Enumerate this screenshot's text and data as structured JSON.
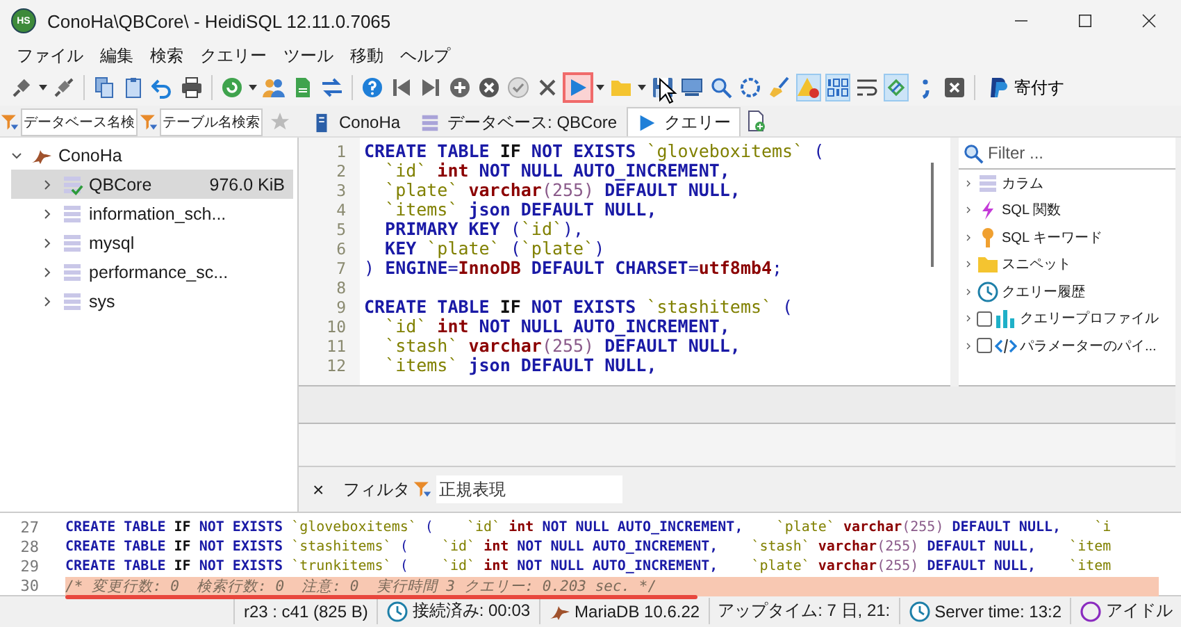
{
  "window": {
    "icon_label": "HS",
    "title": "ConoHa\\QBCore\\ - HeidiSQL 12.11.0.7065"
  },
  "menu": [
    "ファイル",
    "編集",
    "検索",
    "クエリー",
    "ツール",
    "移動",
    "ヘルプ"
  ],
  "toolbar": {
    "run_highlighted": true,
    "toggle_buttons": [
      {
        "pressed": true
      },
      {
        "pressed": true
      },
      {
        "pressed": true
      }
    ],
    "donate_label": "寄付す"
  },
  "search_fields": [
    {
      "placeholder": "データベース名検"
    },
    {
      "placeholder": "テーブル名検索"
    }
  ],
  "tabs": [
    {
      "label": "ConoHa",
      "kind": "server",
      "selected": false
    },
    {
      "label": "データベース: QBCore",
      "kind": "database",
      "selected": false
    },
    {
      "label": "クエリー",
      "kind": "query",
      "selected": true
    }
  ],
  "tree": {
    "label": "ConoHa",
    "expanded": true,
    "children": [
      {
        "label": "QBCore",
        "size": "976.0 KiB",
        "selected": true,
        "active": true
      },
      {
        "label": "information_sch...",
        "selected": false,
        "active": false
      },
      {
        "label": "mysql",
        "selected": false,
        "active": false
      },
      {
        "label": "performance_sc...",
        "selected": false,
        "active": false
      },
      {
        "label": "sys",
        "selected": false,
        "active": false
      }
    ]
  },
  "editor": {
    "lines": [
      {
        "number": "1",
        "tokens": [
          {
            "kind": "keyword",
            "text": "CREATE TABLE "
          },
          {
            "kind": "plainbold",
            "text": "IF "
          },
          {
            "kind": "keyword",
            "text": "NOT EXISTS "
          },
          {
            "kind": "ident",
            "text": "`gloveboxitems`"
          },
          {
            "kind": "symbol",
            "text": " ("
          }
        ]
      },
      {
        "number": "2",
        "tokens": [
          {
            "kind": "ident",
            "text": "  `id`"
          },
          {
            "kind": "type",
            "text": " int"
          },
          {
            "kind": "keyword",
            "text": " NOT NULL AUTO_INCREMENT,"
          }
        ]
      },
      {
        "number": "3",
        "tokens": [
          {
            "kind": "ident",
            "text": "  `plate`"
          },
          {
            "kind": "type",
            "text": " varchar"
          },
          {
            "kind": "number",
            "text": "(255)"
          },
          {
            "kind": "keyword",
            "text": " DEFAULT NULL,"
          }
        ]
      },
      {
        "number": "4",
        "tokens": [
          {
            "kind": "ident",
            "text": "  `items`"
          },
          {
            "kind": "keyword",
            "text": " json DEFAULT NULL,"
          }
        ]
      },
      {
        "number": "5",
        "tokens": [
          {
            "kind": "keyword",
            "text": "  PRIMARY KEY "
          },
          {
            "kind": "symbol",
            "text": "("
          },
          {
            "kind": "ident",
            "text": "`id`"
          },
          {
            "kind": "symbol",
            "text": "),"
          }
        ]
      },
      {
        "number": "6",
        "tokens": [
          {
            "kind": "keyword",
            "text": "  KEY "
          },
          {
            "kind": "ident",
            "text": "`plate`"
          },
          {
            "kind": "symbol",
            "text": " ("
          },
          {
            "kind": "ident",
            "text": "`plate`"
          },
          {
            "kind": "symbol",
            "text": ")"
          }
        ]
      },
      {
        "number": "7",
        "tokens": [
          {
            "kind": "symbol",
            "text": ") "
          },
          {
            "kind": "keyword",
            "text": "ENGINE"
          },
          {
            "kind": "symbol",
            "text": "="
          },
          {
            "kind": "type",
            "text": "InnoDB"
          },
          {
            "kind": "keyword",
            "text": " DEFAULT CHARSET"
          },
          {
            "kind": "symbol",
            "text": "="
          },
          {
            "kind": "type",
            "text": "utf8mb4"
          },
          {
            "kind": "symbol",
            "text": ";"
          }
        ]
      },
      {
        "number": "8"
      },
      {
        "number": "9",
        "tokens": [
          {
            "kind": "keyword",
            "text": "CREATE TABLE "
          },
          {
            "kind": "plainbold",
            "text": "IF "
          },
          {
            "kind": "keyword",
            "text": "NOT EXISTS "
          },
          {
            "kind": "ident",
            "text": "`stashitems`"
          },
          {
            "kind": "symbol",
            "text": " ("
          }
        ]
      },
      {
        "number": "10",
        "tokens": [
          {
            "kind": "ident",
            "text": "  `id`"
          },
          {
            "kind": "type",
            "text": " int"
          },
          {
            "kind": "keyword",
            "text": " NOT NULL AUTO_INCREMENT,"
          }
        ]
      },
      {
        "number": "11",
        "tokens": [
          {
            "kind": "ident",
            "text": "  `stash`"
          },
          {
            "kind": "type",
            "text": " varchar"
          },
          {
            "kind": "number",
            "text": "(255)"
          },
          {
            "kind": "keyword",
            "text": " DEFAULT NULL,"
          }
        ]
      },
      {
        "number": "12",
        "tokens": [
          {
            "kind": "ident",
            "text": "  `items`"
          },
          {
            "kind": "keyword",
            "text": " json DEFAULT NULL,"
          }
        ]
      }
    ]
  },
  "helper": {
    "filter_placeholder": "Filter ...",
    "items": [
      {
        "label": "カラム",
        "kind": "columns"
      },
      {
        "label": "SQL 関数",
        "kind": "function"
      },
      {
        "label": "SQL キーワード",
        "kind": "keyword"
      },
      {
        "label": "スニペット",
        "kind": "snippets"
      },
      {
        "label": "クエリー履歴",
        "kind": "history"
      },
      {
        "label": "クエリープロファイル",
        "kind": "profile",
        "checked": false
      },
      {
        "label": "パラメーターのパイ...",
        "kind": "params",
        "checked": false
      }
    ]
  },
  "filter_bar": {
    "close": "×",
    "label": "フィルタ",
    "placeholder": "正規表現"
  },
  "log": {
    "lines": [
      {
        "number": "27",
        "highlighted": false,
        "underlined": false,
        "tokens": [
          {
            "kind": "keyword",
            "text": "CREATE TABLE "
          },
          {
            "kind": "plainbold",
            "text": "IF "
          },
          {
            "kind": "keyword",
            "text": "NOT EXISTS "
          },
          {
            "kind": "ident",
            "text": "`gloveboxitems`"
          },
          {
            "kind": "symbol",
            "text": " (    "
          },
          {
            "kind": "ident",
            "text": "`id`"
          },
          {
            "kind": "type",
            "text": " int"
          },
          {
            "kind": "keyword",
            "text": " NOT NULL AUTO_INCREMENT,"
          },
          {
            "kind": "ident",
            "text": "    `plate`"
          },
          {
            "kind": "type",
            "text": " varchar"
          },
          {
            "kind": "number",
            "text": "(255)"
          },
          {
            "kind": "keyword",
            "text": " DEFAULT NULL,"
          },
          {
            "kind": "ident",
            "text": "    `i"
          }
        ]
      },
      {
        "number": "28",
        "highlighted": false,
        "underlined": false,
        "tokens": [
          {
            "kind": "keyword",
            "text": "CREATE TABLE "
          },
          {
            "kind": "plainbold",
            "text": "IF "
          },
          {
            "kind": "keyword",
            "text": "NOT EXISTS "
          },
          {
            "kind": "ident",
            "text": "`stashitems`"
          },
          {
            "kind": "symbol",
            "text": " (    "
          },
          {
            "kind": "ident",
            "text": "`id`"
          },
          {
            "kind": "type",
            "text": " int"
          },
          {
            "kind": "keyword",
            "text": " NOT NULL AUTO_INCREMENT,"
          },
          {
            "kind": "ident",
            "text": "    `stash`"
          },
          {
            "kind": "type",
            "text": " varchar"
          },
          {
            "kind": "number",
            "text": "(255)"
          },
          {
            "kind": "keyword",
            "text": " DEFAULT NULL,"
          },
          {
            "kind": "ident",
            "text": "    `item"
          }
        ]
      },
      {
        "number": "29",
        "highlighted": false,
        "underlined": false,
        "tokens": [
          {
            "kind": "keyword",
            "text": "CREATE TABLE "
          },
          {
            "kind": "plainbold",
            "text": "IF "
          },
          {
            "kind": "keyword",
            "text": "NOT EXISTS "
          },
          {
            "kind": "ident",
            "text": "`trunkitems`"
          },
          {
            "kind": "symbol",
            "text": " (    "
          },
          {
            "kind": "ident",
            "text": "`id`"
          },
          {
            "kind": "type",
            "text": " int"
          },
          {
            "kind": "keyword",
            "text": " NOT NULL AUTO_INCREMENT,"
          },
          {
            "kind": "ident",
            "text": "    `plate`"
          },
          {
            "kind": "type",
            "text": " varchar"
          },
          {
            "kind": "number",
            "text": "(255)"
          },
          {
            "kind": "keyword",
            "text": " DEFAULT NULL,"
          },
          {
            "kind": "ident",
            "text": "    `item"
          }
        ]
      },
      {
        "number": "30",
        "highlighted": true,
        "underlined": true,
        "tokens": [
          {
            "kind": "comment",
            "text": "/* 変更行数: 0  検索行数: 0  注意: 0  実行時間 3 クエリー: 0.203 sec. */"
          }
        ]
      }
    ]
  },
  "status_bar": [
    {
      "text": "r23 : c41 (825 B)",
      "kind": "plain"
    },
    {
      "text": "接続済み: 00:03",
      "kind": "clock"
    },
    {
      "text": "MariaDB 10.6.22",
      "kind": "server"
    },
    {
      "text": "アップタイム: 7 日, 21:",
      "kind": "plain"
    },
    {
      "text": "Server time: 13:2",
      "kind": "clock"
    },
    {
      "text": "アイドル",
      "kind": "idle"
    }
  ]
}
